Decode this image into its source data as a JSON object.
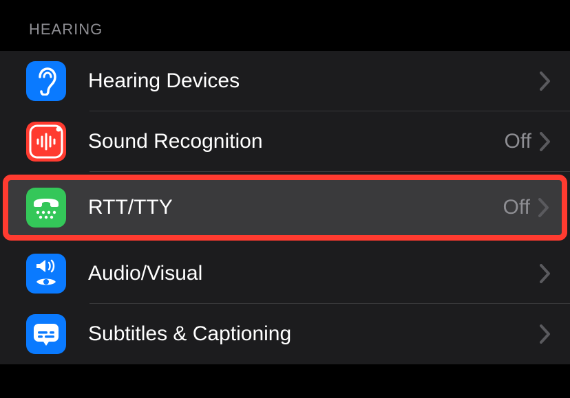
{
  "section": {
    "title": "Hearing"
  },
  "rows": {
    "hearing_devices": {
      "label": "Hearing Devices",
      "value": "",
      "icon": "ear-icon",
      "icon_color": "#0a7aff"
    },
    "sound_recognition": {
      "label": "Sound Recognition",
      "value": "Off",
      "icon": "waveform-icon",
      "icon_color": "#ff3b30"
    },
    "rtt_tty": {
      "label": "RTT/TTY",
      "value": "Off",
      "icon": "tty-icon",
      "icon_color": "#34c759",
      "highlighted": true
    },
    "audio_visual": {
      "label": "Audio/Visual",
      "value": "",
      "icon": "speaker-eye-icon",
      "icon_color": "#0a7aff"
    },
    "subtitles_captioning": {
      "label": "Subtitles & Captioning",
      "value": "",
      "icon": "caption-icon",
      "icon_color": "#0a7aff"
    }
  }
}
